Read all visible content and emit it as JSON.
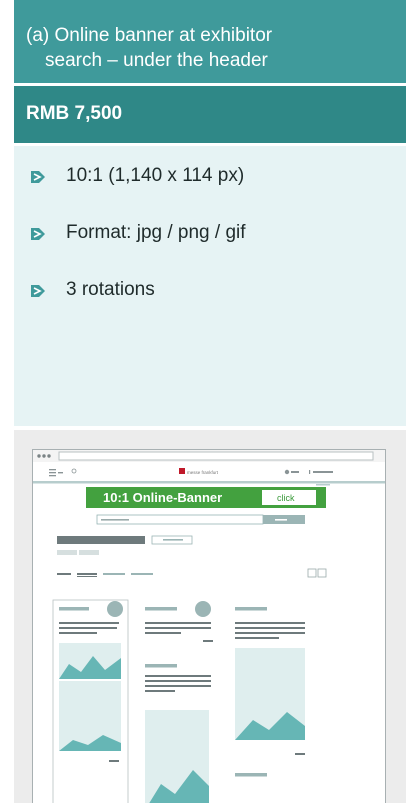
{
  "header": {
    "line1": "(a) Online banner at exhibitor",
    "line2": "search – under the header"
  },
  "price": "RMB 7,500",
  "features": [
    "10:1 (1,140 x 114 px)",
    "Format: jpg / png / gif",
    "3 rotations"
  ],
  "mockup": {
    "brand": "messe frankfurt",
    "banner_text": "10:1 Online-Banner",
    "banner_button": "click"
  },
  "colors": {
    "header_bg": "#3f9a9b",
    "price_bg": "#2f8887",
    "list_bg": "#e6f3f4",
    "banner_green": "#3a9a3a"
  }
}
